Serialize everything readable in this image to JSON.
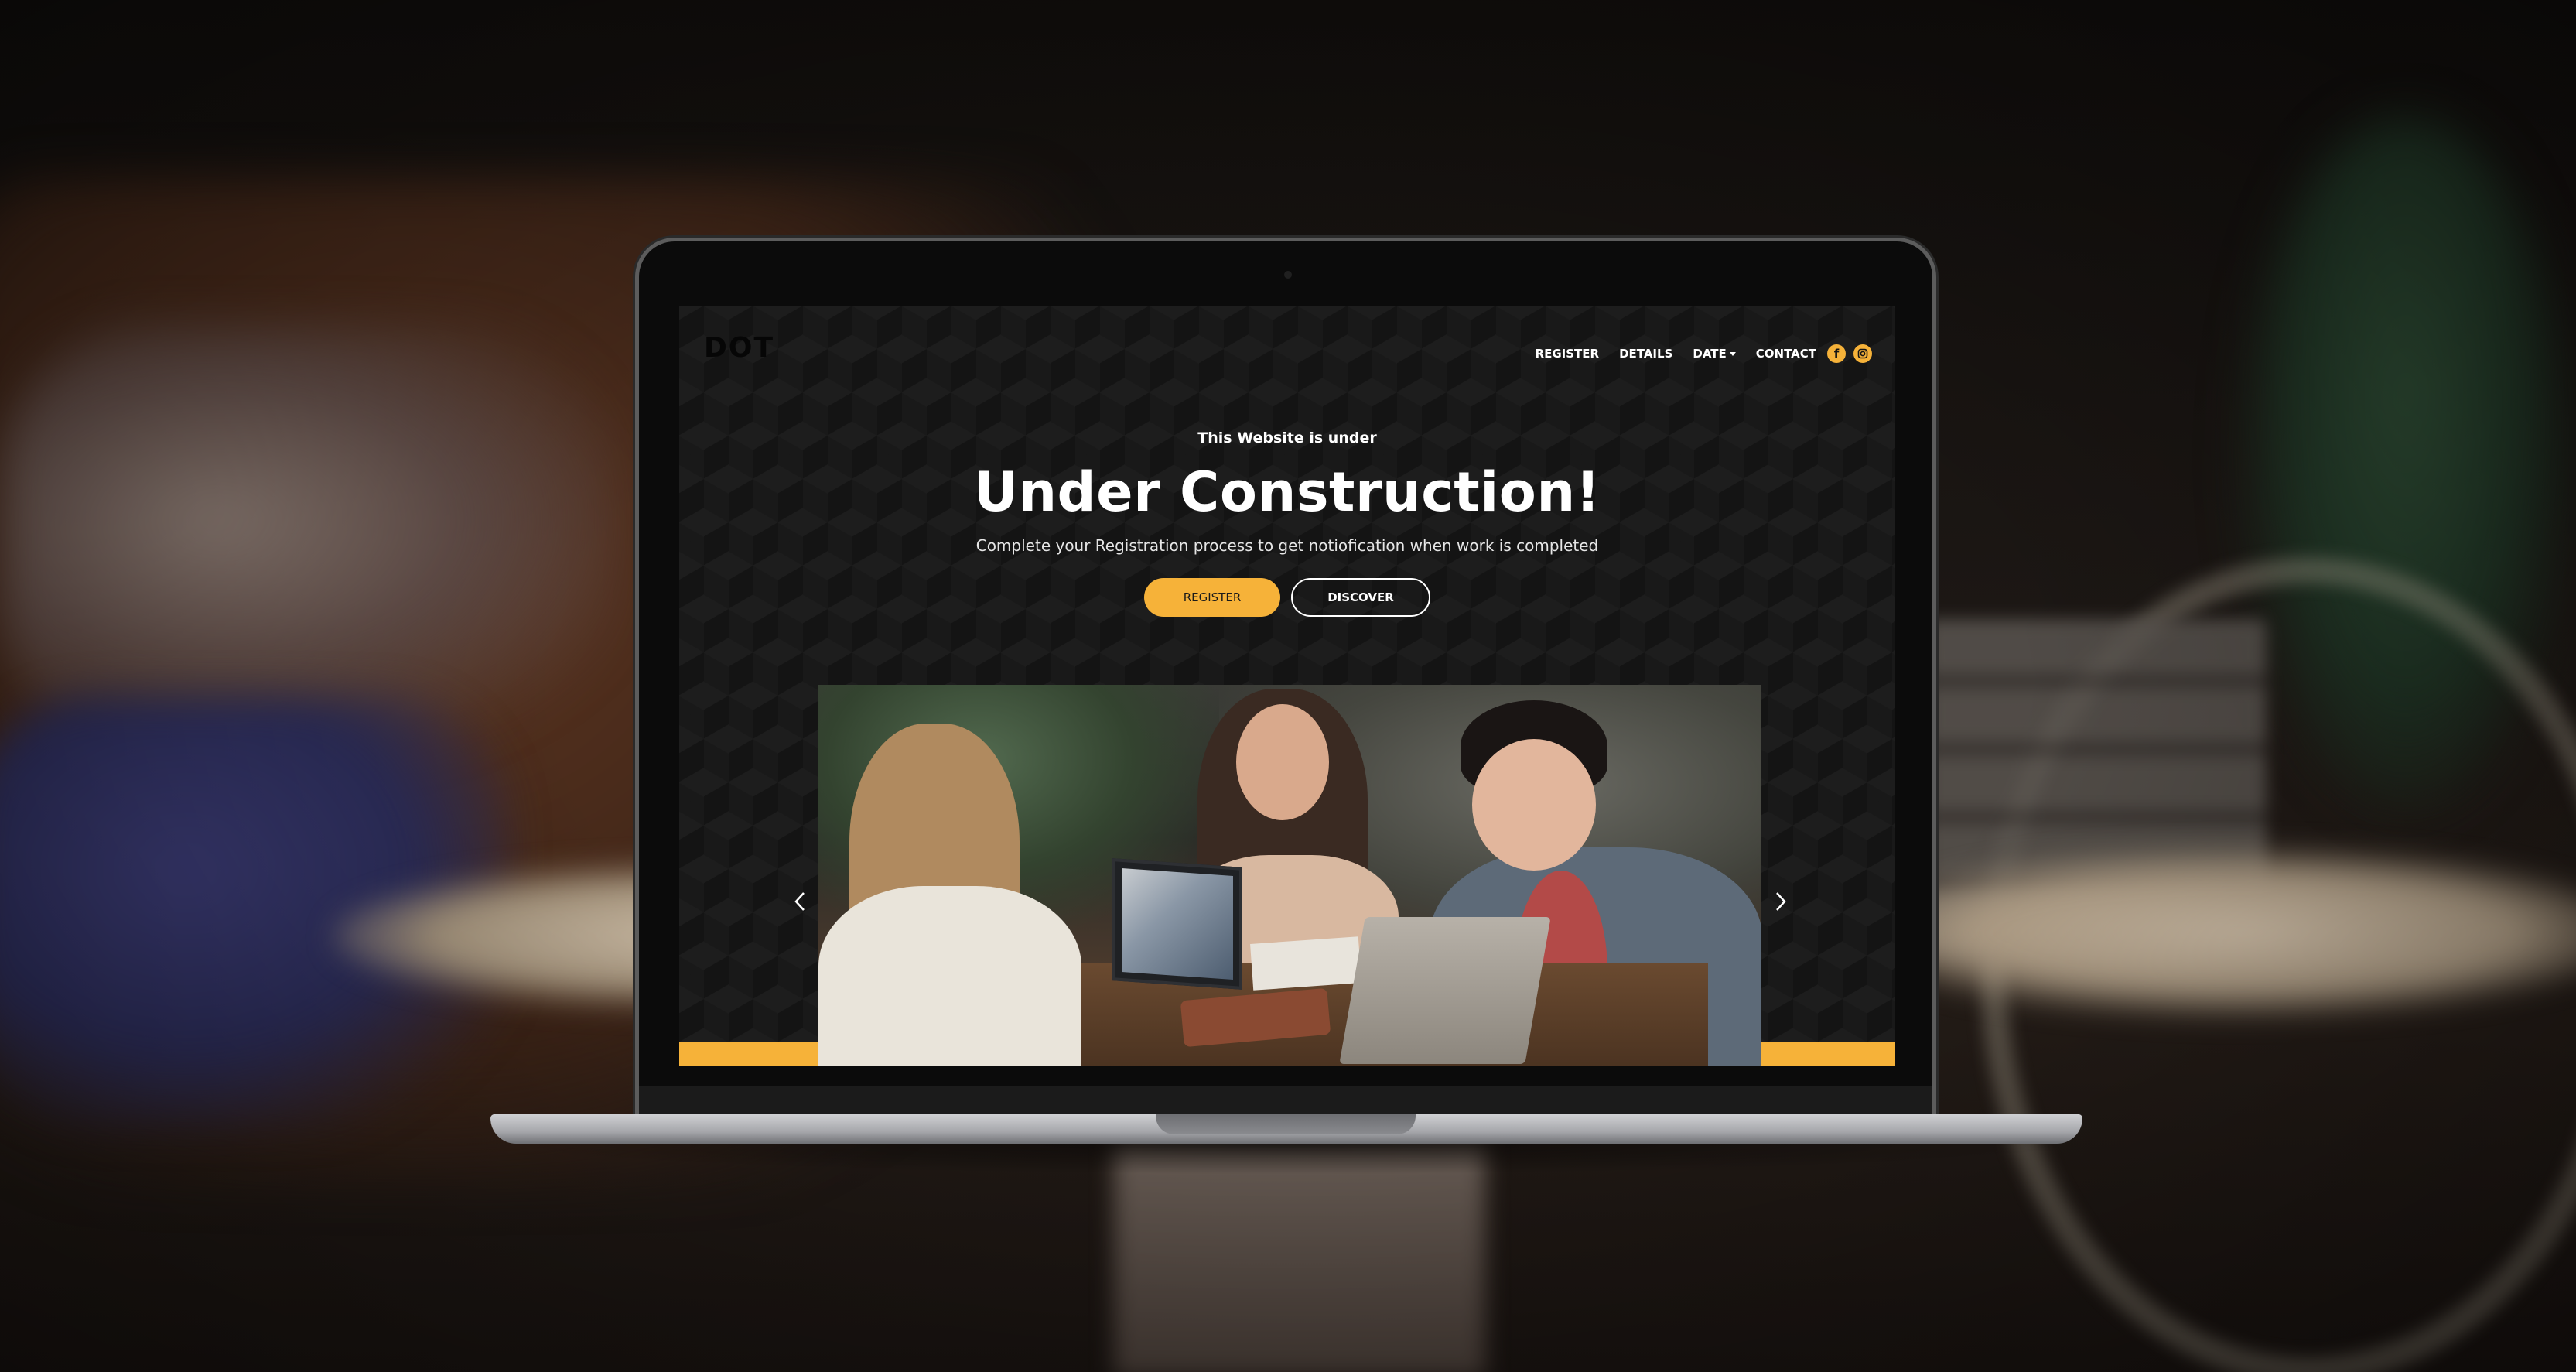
{
  "site": {
    "logo_text": "DOT"
  },
  "nav": {
    "items": [
      {
        "label": "REGISTER"
      },
      {
        "label": "DETAILS"
      },
      {
        "label": "DATE"
      },
      {
        "label": "CONTACT"
      }
    ],
    "social": [
      {
        "icon": "facebook-icon",
        "glyph": "f"
      },
      {
        "icon": "instagram-icon"
      }
    ]
  },
  "hero": {
    "kicker": "This Website is under",
    "headline": "Under Construction!",
    "subtext": "Complete your Registration process to get notiofication when work is completed",
    "primary_button": "REGISTER",
    "secondary_button": "DISCOVER"
  },
  "slider": {
    "prev_icon": "chevron-left-icon",
    "next_icon": "chevron-right-icon"
  },
  "colors": {
    "accent": "#f6b239",
    "background": "#141414",
    "text": "#ffffff"
  }
}
